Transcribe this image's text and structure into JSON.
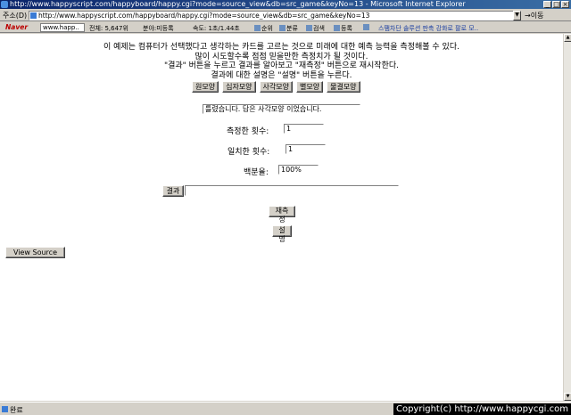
{
  "window": {
    "title": "http://www.happyscript.com/happyboard/happy.cgi?mode=source_view&db=src_game&keyNo=13 - Microsoft Internet Explorer"
  },
  "address_bar": {
    "label": "주소(D)",
    "url": "http://www.happyscript.com/happyboard/happy.cgi?mode=source_view&db=src_game&keyNo=13",
    "go_label": "이동"
  },
  "link_bar": {
    "logo": "Naver",
    "search_value": "www.happ..",
    "rank": "전체: 5,647위",
    "category": "분야:미등록",
    "speed": "속도: 1초/1.44초",
    "rank_btn": "순위",
    "category_btn": "분류",
    "search_btn": "검색",
    "register_btn": "등록",
    "promo": "스팸차단 솔루션 판촉 강화로 팔로 모.."
  },
  "page": {
    "intro_lines": [
      "이 예제는 컴퓨터가 선택했다고 생각하는 카드를 고르는 것으로 미래에 대한 예측 능력을 측정해볼 수 있다.",
      "많이 시도할수록 점점 믿을만한 측정치가 될 것이다.",
      "\"결과\" 버튼을 누르고 결과를 알아보고 \"재측정\" 버튼으로 재시작한다.",
      "결과에 대한 설명은 \"설명\" 버튼을 누른다."
    ],
    "shape_buttons": [
      "원모양",
      "십자모양",
      "사각모양",
      "별모양",
      "물결모양"
    ],
    "result_message": "틀렸습니다. 답은 사각모양 이었습니다.",
    "tries_label": "측정한 횟수:",
    "tries_value": "1",
    "matches_label": "일치한 횟수:",
    "matches_value": "1",
    "percent_label": "백분율:",
    "percent_value": "100%",
    "result_button": "결과",
    "result_field_value": "",
    "retry_button": "재측정",
    "explain_button": "설명",
    "view_source_button": "View Source"
  },
  "status_bar": {
    "status": "완료",
    "copyright": "Copyright(c) http://www.happycgi.com"
  }
}
